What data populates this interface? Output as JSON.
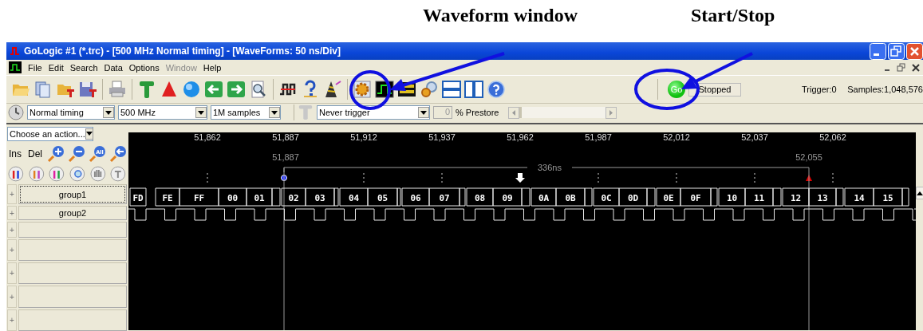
{
  "annotations": [
    {
      "label": "Waveform window"
    },
    {
      "label": "Start/Stop"
    }
  ],
  "window": {
    "title": "GoLogic #1 (*.trc) - [500 MHz Normal timing] - [WaveForms: 50 ns/Div]"
  },
  "menu": [
    {
      "label": "File",
      "disabled": false
    },
    {
      "label": "Edit",
      "disabled": false
    },
    {
      "label": "Search",
      "disabled": false
    },
    {
      "label": "Data",
      "disabled": false
    },
    {
      "label": "Options",
      "disabled": false
    },
    {
      "label": "Window",
      "disabled": true
    },
    {
      "label": "Help",
      "disabled": false
    }
  ],
  "status": {
    "go_button": "Go",
    "state": "Stopped",
    "trigger": "Trigger:0",
    "samples": "Samples:1,048,576"
  },
  "settings": {
    "mode": "Normal timing",
    "rate": "500 MHz",
    "depth": "1M samples",
    "trigger": "Never trigger",
    "prestore_value": "0",
    "prestore_label": "% Prestore",
    "prestore_slider": {
      "level": 0
    }
  },
  "sidebar": {
    "action": "Choose an action...",
    "insert": "Ins",
    "delete": "Del",
    "zoom_all": "All",
    "rows": [
      {
        "expander": "+",
        "name": "group1",
        "selected": true
      },
      {
        "expander": "+",
        "name": "group2",
        "selected": false
      },
      {
        "expander": "+",
        "selected": false
      },
      {
        "expander": "+",
        "selected": false
      },
      {
        "expander": "+",
        "selected": false
      },
      {
        "expander": "+",
        "selected": false
      },
      {
        "expander": "+",
        "selected": false
      }
    ]
  },
  "waveform": {
    "time_labels": [
      "51,862",
      "51,887",
      "51,912",
      "51,937",
      "51,962",
      "51,987",
      "52,012",
      "52,037",
      "52,062"
    ],
    "cursor_a": "51,887",
    "cursor_b": "52,055",
    "span": "336ns",
    "bus": [
      "FD",
      "FE",
      "FF",
      "00",
      "01",
      "02",
      "03",
      "04",
      "05",
      "06",
      "07",
      "08",
      "09",
      "0A",
      "0B",
      "0C",
      "0D",
      "0E",
      "0F",
      "10",
      "11",
      "12",
      "13",
      "14",
      "15"
    ]
  }
}
